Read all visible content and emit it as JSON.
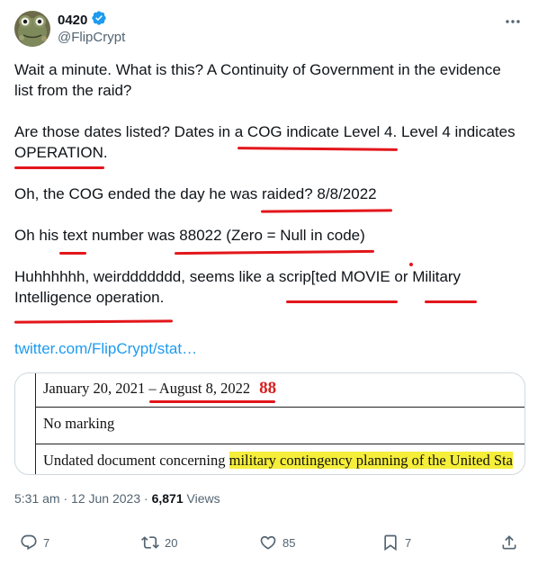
{
  "author": {
    "display_name": "0420",
    "handle": "@FlipCrypt",
    "verified": true,
    "avatar": "frog-avatar"
  },
  "tweet": {
    "paragraphs": [
      "Wait a minute. What is this? A Continuity of Government in the evidence list from the raid?",
      "Are those dates listed? Dates in a COG indicate Level 4. Level 4 indicates OPERATION.",
      "Oh, the COG ended the day he was raided? 8/8/2022",
      "Oh his text number was 88022 (Zero = Null in code)",
      "Huhhhhhh, weirddddddd, seems like a scrip[ted MOVIE or Military Intelligence operation."
    ],
    "p1_line1": "Wait a minute. What is this? A Continuity of Government in the evidence",
    "p1_line2": "list from the raid?",
    "p2_line1": "Are those dates listed? Dates in a COG indicate Level 4. Level 4 indicates",
    "p2_line2": "OPERATION.",
    "p3_line1": "Oh, the COG ended the day he was raided? 8/8/2022",
    "p4_line1": "Oh his text number was 88022 (Zero = Null in code)",
    "p5_line1": "Huhhhhhh, weirddddddd, seems like a scrip[ted MOVIE or Military",
    "p5_line2": "Intelligence operation.",
    "link": "twitter.com/FlipCrypt/stat…",
    "annotation_color": "#e3161b"
  },
  "media": {
    "rows": [
      {
        "date_start": "January 20, 2021 – ",
        "date_end": "August 8, 2022",
        "annotation": "88"
      },
      {
        "text": "No marking"
      },
      {
        "prefix": "Undated document concerning ",
        "highlight": "military contingency planning of the United Sta"
      }
    ],
    "highlight_color": "#f5ee3a"
  },
  "meta": {
    "time": "5:31 am",
    "separator": "·",
    "date": "12 Jun 2023",
    "views_count": "6,871",
    "views_label": "Views"
  },
  "actions": {
    "replies": "7",
    "retweets": "20",
    "likes": "85",
    "bookmarks": "7"
  },
  "colors": {
    "text": "#0f1419",
    "secondary": "#536471",
    "link": "#1d9bf0",
    "verified": "#1d9bf0"
  }
}
